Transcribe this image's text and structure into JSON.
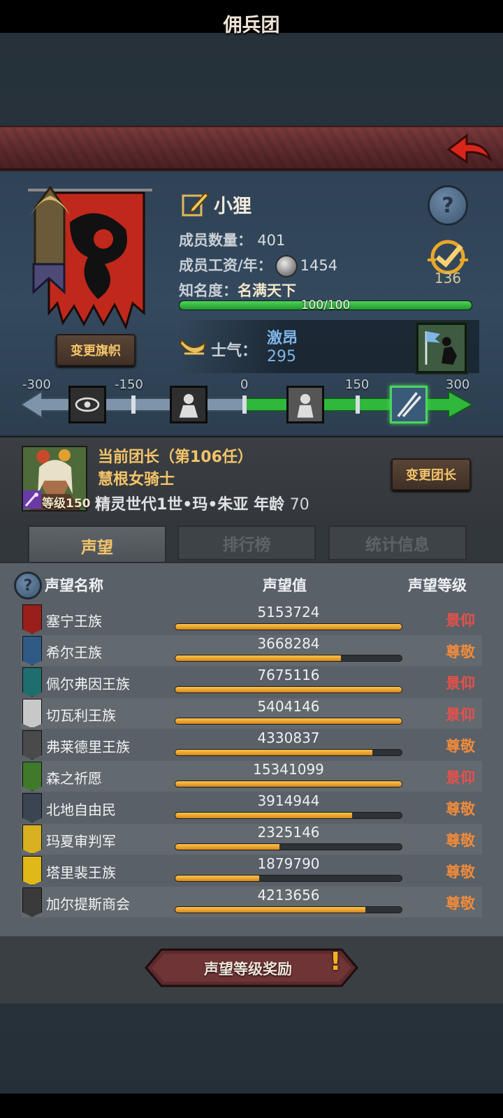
{
  "title": "佣兵团",
  "company": {
    "name": "小狸",
    "members_label": "成员数量：",
    "members_value": "401",
    "salary_label": "成员工资/年：",
    "salary_value": "1454",
    "fame_label": "知名度：",
    "fame_value": "名满天下",
    "fame_progress_text": "100/100",
    "fame_progress": 1.0,
    "achievement_count": "136",
    "change_flag_label": "变更旗帜",
    "morale_label": "士气：",
    "morale_state": "激昂",
    "morale_value": "295"
  },
  "morale_scale": {
    "ticks": [
      "-300",
      "-150",
      "0",
      "150",
      "300"
    ],
    "active_level": "300"
  },
  "leader": {
    "title_line": "当前团长（第106任）",
    "class_name": "慧根女骑士",
    "level_text": "等级150",
    "name": "精灵世代1世•玛•朱亚",
    "age_label": "年龄",
    "age_value": "70",
    "change_leader_label": "变更团长"
  },
  "tabs": [
    {
      "label": "声望",
      "active": true
    },
    {
      "label": "排行榜",
      "active": false
    },
    {
      "label": "统计信息",
      "active": false
    }
  ],
  "table": {
    "col_name": "声望名称",
    "col_value": "声望值",
    "col_level": "声望等级",
    "rows": [
      {
        "name": "塞宁王族",
        "value": "5153724",
        "level": "景仰",
        "progress": 1.0,
        "crest_color": "#9a1f1a",
        "level_color": "#e8504a"
      },
      {
        "name": "希尔王族",
        "value": "3668284",
        "level": "尊敬",
        "progress": 0.73,
        "crest_color": "#2f5a86",
        "level_color": "#f08a3a"
      },
      {
        "name": "佩尔弗因王族",
        "value": "7675116",
        "level": "景仰",
        "progress": 1.0,
        "crest_color": "#1f6e6e",
        "level_color": "#e8504a"
      },
      {
        "name": "切瓦利王族",
        "value": "5404146",
        "level": "景仰",
        "progress": 1.0,
        "crest_color": "#c8c8c8",
        "level_color": "#e8504a"
      },
      {
        "name": "弗莱德里王族",
        "value": "4330837",
        "level": "尊敬",
        "progress": 0.87,
        "crest_color": "#4a4a4a",
        "level_color": "#f08a3a"
      },
      {
        "name": "森之祈愿",
        "value": "15341099",
        "level": "景仰",
        "progress": 1.0,
        "crest_color": "#3e7a2a",
        "level_color": "#e8504a"
      },
      {
        "name": "北地自由民",
        "value": "3914944",
        "level": "尊敬",
        "progress": 0.78,
        "crest_color": "#3a4452",
        "level_color": "#f08a3a"
      },
      {
        "name": "玛夏审判军",
        "value": "2325146",
        "level": "尊敬",
        "progress": 0.46,
        "crest_color": "#d8b020",
        "level_color": "#f08a3a"
      },
      {
        "name": "塔里裴王族",
        "value": "1879790",
        "level": "尊敬",
        "progress": 0.37,
        "crest_color": "#e0b818",
        "level_color": "#f08a3a"
      },
      {
        "name": "加尔提斯商会",
        "value": "4213656",
        "level": "尊敬",
        "progress": 0.84,
        "crest_color": "#3a3a3a",
        "level_color": "#f08a3a"
      }
    ]
  },
  "reward_button_label": "声望等级奖励",
  "colors": {
    "accent_gold": "#f4c46a",
    "revere_red": "#e8504a",
    "respect_orange": "#f08a3a",
    "morale_blue": "#7fb6e8",
    "fame_green": "#2fb83c"
  }
}
